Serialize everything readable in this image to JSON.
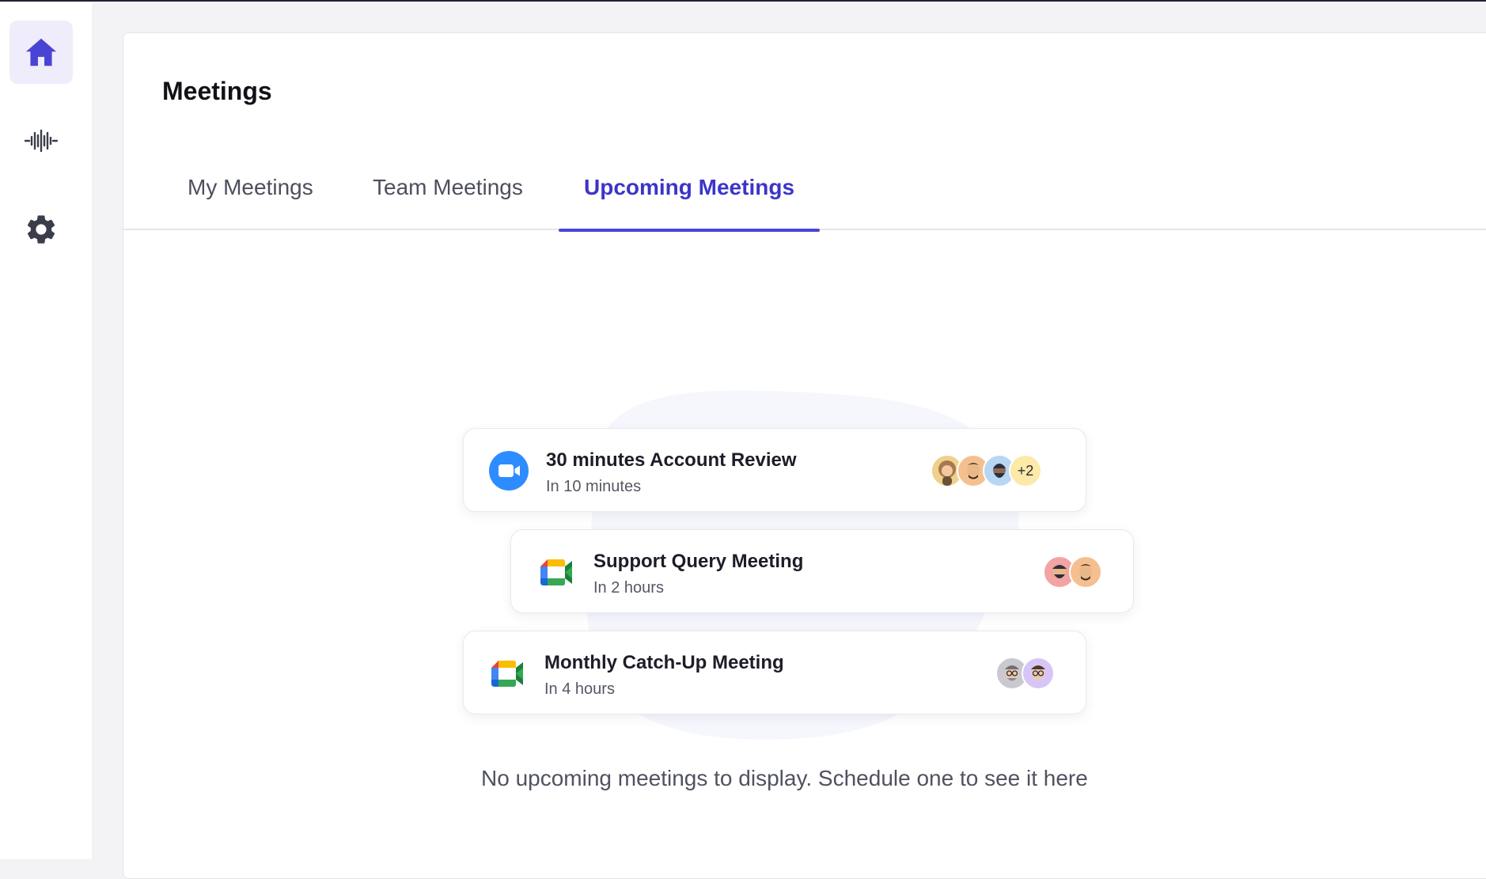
{
  "sidebar": {
    "items": [
      {
        "icon": "home-icon",
        "active": true
      },
      {
        "icon": "soundwave-icon",
        "active": false
      },
      {
        "icon": "gear-icon",
        "active": false
      }
    ]
  },
  "main": {
    "title": "Meetings",
    "tabs": [
      {
        "label": "My Meetings",
        "active": false
      },
      {
        "label": "Team Meetings",
        "active": false
      },
      {
        "label": "Upcoming Meetings",
        "active": true
      }
    ]
  },
  "meetings": [
    {
      "title": "30 minutes Account Review",
      "time": "In 10 minutes",
      "app": "zoom-icon",
      "extra_attendees": "+2"
    },
    {
      "title": "Support Query Meeting",
      "time": "In 2 hours",
      "app": "google-meet-icon"
    },
    {
      "title": "Monthly Catch-Up Meeting",
      "time": "In 4 hours",
      "app": "google-meet-icon"
    }
  ],
  "empty_state": {
    "message": "No upcoming meetings to display. Schedule one to see it here"
  },
  "colors": {
    "accent": "#4a44d4",
    "accent_text": "#3c35c9",
    "active_nav_bg": "#efedfb",
    "zoom_blue": "#2d8cff"
  }
}
